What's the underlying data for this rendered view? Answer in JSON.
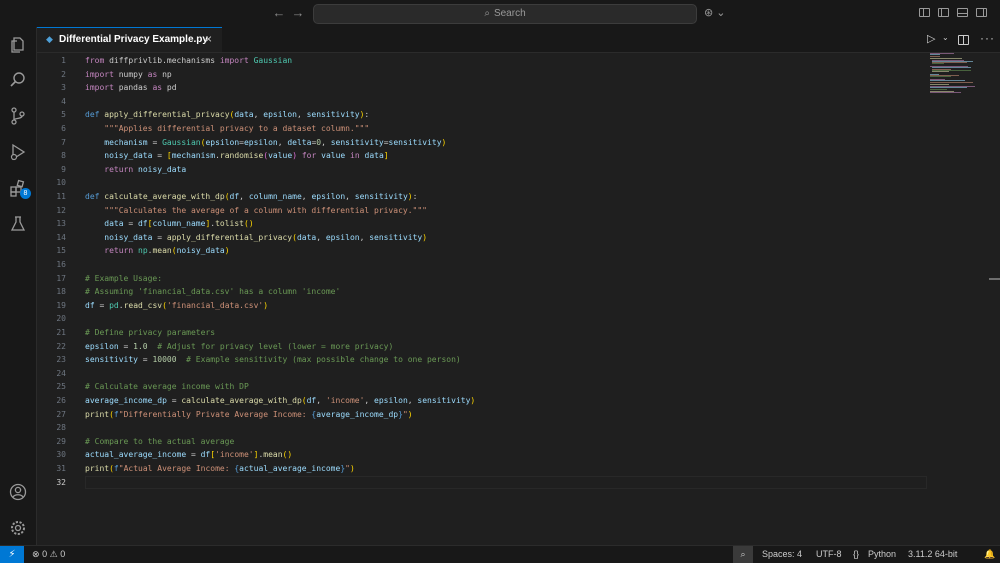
{
  "titlebar": {
    "search_placeholder": "Search"
  },
  "activitybar": {
    "extensions_badge": "8"
  },
  "tab": {
    "label": "Differential Privacy Example.py",
    "close": "×"
  },
  "editor": {
    "line_numbers": [
      "1",
      "2",
      "3",
      "4",
      "5",
      "6",
      "7",
      "8",
      "9",
      "10",
      "11",
      "12",
      "13",
      "14",
      "15",
      "16",
      "17",
      "18",
      "19",
      "20",
      "21",
      "22",
      "23",
      "24",
      "25",
      "26",
      "27",
      "28",
      "29",
      "30",
      "31",
      "32"
    ],
    "current_line": 32
  },
  "statusbar": {
    "errors": "0",
    "warnings": "0",
    "spaces": "Spaces: 4",
    "encoding": "UTF-8",
    "language": "Python",
    "python_version": "3.11.2 64-bit"
  },
  "colors": {
    "accent": "#0078d4",
    "keyword": "#c586c0",
    "string": "#ce9178",
    "comment": "#6a9955",
    "function": "#dcdcaa"
  }
}
